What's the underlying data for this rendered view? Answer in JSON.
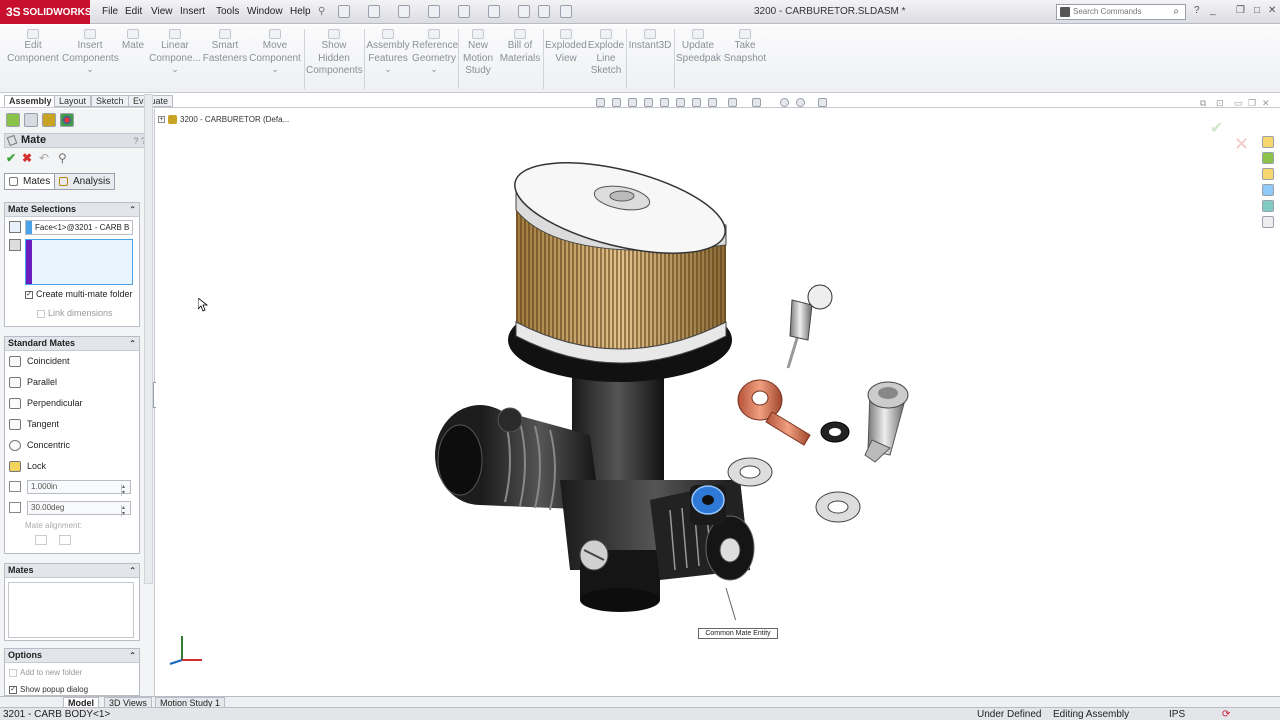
{
  "app": {
    "logo": "SOLIDWORKS",
    "document_title": "3200 - CARBURETOR.SLDASM *"
  },
  "menu": [
    "File",
    "Edit",
    "View",
    "Insert",
    "Tools",
    "Window",
    "Help"
  ],
  "search": {
    "placeholder": "Search Commands"
  },
  "ribbon": [
    {
      "label": "Edit\nComponent",
      "icon": "edit-component-icon",
      "dropdown": false
    },
    {
      "label": "Insert\nComponents",
      "icon": "insert-components-icon",
      "dropdown": true
    },
    {
      "label": "Mate",
      "icon": "mate-icon",
      "dropdown": false
    },
    {
      "label": "Linear\nCompone...",
      "icon": "linear-pattern-icon",
      "dropdown": true
    },
    {
      "label": "Smart\nFasteners",
      "icon": "smart-fasteners-icon",
      "dropdown": false
    },
    {
      "label": "Move\nComponent",
      "icon": "move-component-icon",
      "dropdown": true
    },
    {
      "label": "Show\nHidden\nComponents",
      "icon": "show-hidden-icon",
      "dropdown": false
    },
    {
      "label": "Assembly\nFeatures",
      "icon": "assembly-features-icon",
      "dropdown": true
    },
    {
      "label": "Reference\nGeometry",
      "icon": "reference-geometry-icon",
      "dropdown": true
    },
    {
      "label": "New\nMotion\nStudy",
      "icon": "motion-study-icon",
      "dropdown": false
    },
    {
      "label": "Bill of\nMaterials",
      "icon": "bom-icon",
      "dropdown": false
    },
    {
      "label": "Exploded\nView",
      "icon": "exploded-view-icon",
      "dropdown": false
    },
    {
      "label": "Explode\nLine\nSketch",
      "icon": "explode-line-icon",
      "dropdown": false
    },
    {
      "label": "Instant3D",
      "icon": "instant3d-icon",
      "dropdown": false
    },
    {
      "label": "Update\nSpeedpak",
      "icon": "speedpak-icon",
      "dropdown": false
    },
    {
      "label": "Take\nSnapshot",
      "icon": "snapshot-icon",
      "dropdown": false
    }
  ],
  "command_tabs": [
    "Assembly",
    "Layout",
    "Sketch",
    "Evaluate"
  ],
  "panel": {
    "title": "Mate",
    "help": "? ?",
    "tabs": [
      "Mates",
      "Analysis"
    ],
    "mate_selections": {
      "header": "Mate Selections",
      "selection": "Face<1>@3201 - CARB B",
      "create_multi_mate": "Create multi-mate folder",
      "link_dimensions": "Link dimensions"
    },
    "standard_mates": {
      "header": "Standard Mates",
      "items": [
        "Coincident",
        "Parallel",
        "Perpendicular",
        "Tangent",
        "Concentric",
        "Lock"
      ],
      "distance": "1.000in",
      "angle": "30.00deg",
      "alignment": "Mate alignment:"
    },
    "mates_header": "Mates",
    "options": {
      "header": "Options",
      "items": [
        "Add to new folder",
        "Show popup dialog"
      ]
    }
  },
  "graphics": {
    "tree_root": "3200 - CARBURETOR (Defa...",
    "callout": "Common Mate Entity"
  },
  "bottom_tabs": [
    "Model",
    "3D Views",
    "Motion Study 1"
  ],
  "status": {
    "selection": "3201 - CARB BODY<1>",
    "state": "Under Defined",
    "mode": "Editing Assembly",
    "units": "IPS"
  }
}
